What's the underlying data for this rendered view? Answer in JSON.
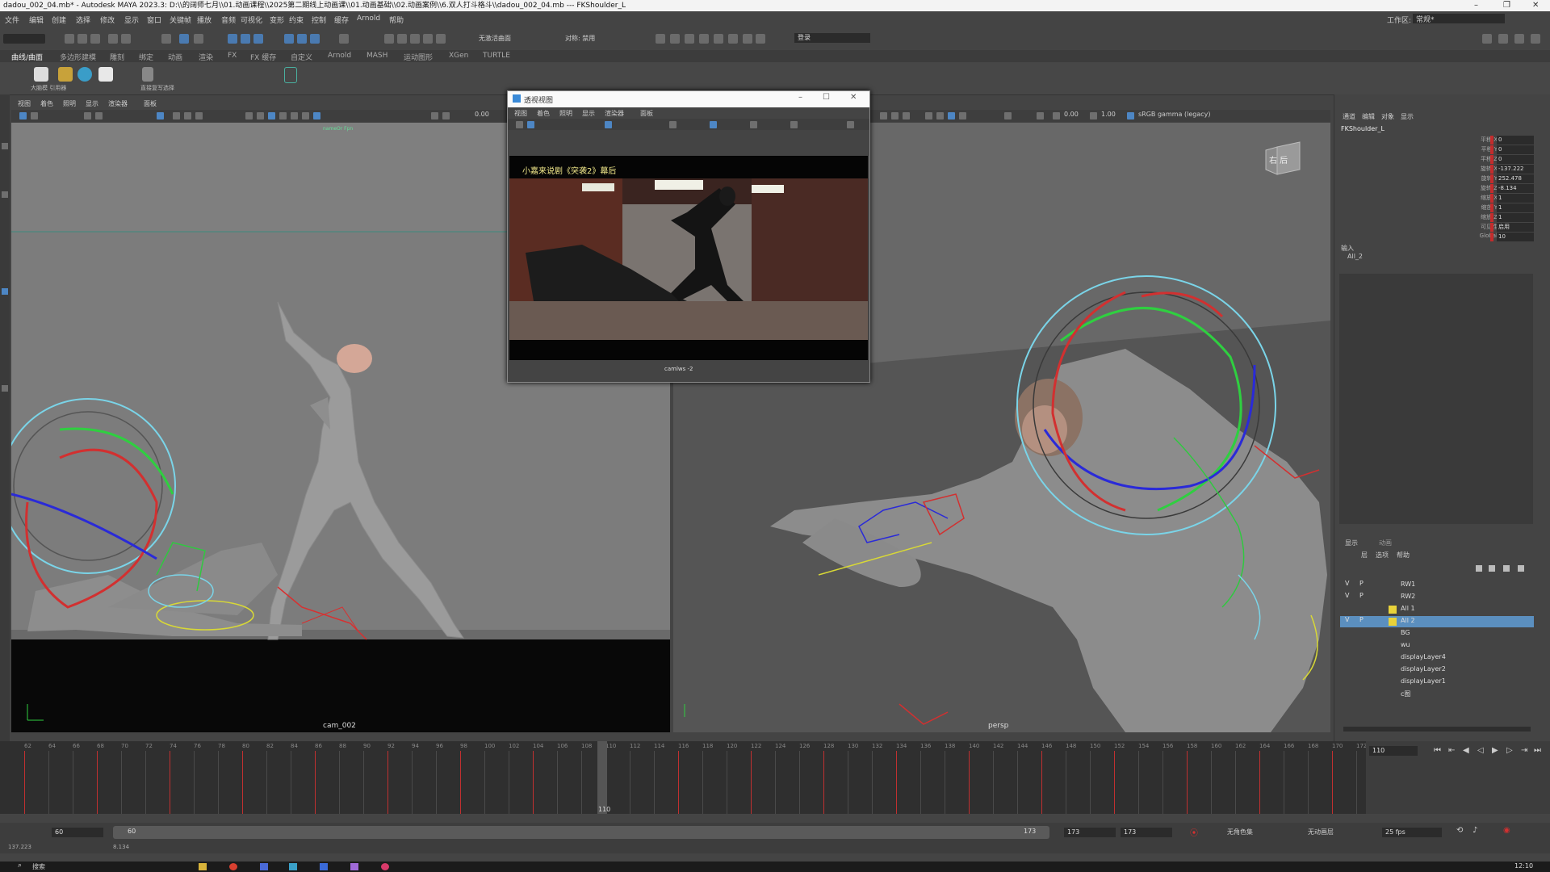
{
  "window": {
    "title": "dadou_002_04.mb* - Autodesk MAYA 2023.3: D:\\\\的阔师七月\\\\01.动画课程\\\\2025第二期线上动画课\\\\01.动画基础\\\\02.动画案例\\\\6.双人打斗格斗\\\\dadou_002_04.mb   ---   FKShoulder_L",
    "minimize": "–",
    "maximize": "❐",
    "close": "✕",
    "workspace_label": "工作区:",
    "workspace_value": "常规*"
  },
  "menubar": [
    "文件",
    "编辑",
    "创建",
    "选择",
    "修改",
    "显示",
    "窗口",
    "关键帧",
    "播放",
    "音频",
    "可视化",
    "变形",
    "约束",
    "控制",
    "缓存",
    "Arnold",
    "帮助"
  ],
  "toolbar": {
    "sym_off": "无激活曲面",
    "sym_label": "对称: 禁用",
    "login": "登录"
  },
  "shelf_tabs": [
    "曲线/曲面",
    "多边形建模",
    "雕刻",
    "绑定",
    "动画",
    "渲染",
    "FX",
    "FX 缓存",
    "自定义",
    "Arnold",
    "MASH",
    "运动图形",
    "XGen",
    "TURTLE"
  ],
  "shelf_captions": [
    "大脑模 引用器",
    "直接复写选择"
  ],
  "viewport_left": {
    "menus": [
      "视图",
      "着色",
      "照明",
      "显示",
      "渲染器",
      "面板"
    ],
    "field": "0.00",
    "camera_label": "cam_002",
    "top_label": "nameOr Fpn"
  },
  "viewport_right": {
    "menus": [
      "视图",
      "着色",
      "照明",
      "显示",
      "渲染器",
      "面板"
    ],
    "field1": "0.00",
    "field2": "1.00",
    "colorspace": "sRGB gamma (legacy)",
    "camera_label": "persp",
    "viewcube": "右 后"
  },
  "float_window": {
    "title": "透视视图",
    "menus": [
      "视图",
      "着色",
      "照明",
      "显示",
      "渲染器",
      "面板"
    ],
    "subtitle_text": "小嘉来说剧《突袭2》幕后",
    "camera_label": "camlws -2"
  },
  "channel_box": {
    "tabs": [
      "通道",
      "编辑",
      "对象",
      "显示"
    ],
    "object": "FKShoulder_L",
    "channels": [
      {
        "name": "平移 X",
        "value": "0"
      },
      {
        "name": "平移 Y",
        "value": "0"
      },
      {
        "name": "平移 Z",
        "value": "0"
      },
      {
        "name": "旋转 X",
        "value": "-137.222"
      },
      {
        "name": "旋转 Y",
        "value": "252.478"
      },
      {
        "name": "旋转 Z",
        "value": "-8.134"
      },
      {
        "name": "缩放 X",
        "value": "1"
      },
      {
        "name": "缩放 Y",
        "value": "1"
      },
      {
        "name": "缩放 Z",
        "value": "1"
      },
      {
        "name": "可见性",
        "value": "启用"
      },
      {
        "name": "Global",
        "value": "10"
      }
    ],
    "inputs_label": "输入",
    "inputs_value": "All_2"
  },
  "layer_editor": {
    "tabs": [
      "显示",
      "动画"
    ],
    "menus": [
      "层",
      "选项",
      "帮助"
    ],
    "layers": [
      {
        "v": "V",
        "p": "P",
        "name": "RW1",
        "color": "",
        "selected": false
      },
      {
        "v": "V",
        "p": "P",
        "name": "RW2",
        "color": "",
        "selected": false
      },
      {
        "v": "",
        "p": "",
        "name": "All 1",
        "color": "#e8d23a",
        "selected": false
      },
      {
        "v": "V",
        "p": "P",
        "name": "All 2",
        "color": "#e8d23a",
        "selected": true
      },
      {
        "v": "",
        "p": "",
        "name": "BG",
        "color": "",
        "selected": false
      },
      {
        "v": "",
        "p": "",
        "name": "wu",
        "color": "",
        "selected": false
      },
      {
        "v": "",
        "p": "",
        "name": "displayLayer4",
        "color": "",
        "selected": false
      },
      {
        "v": "",
        "p": "",
        "name": "displayLayer2",
        "color": "",
        "selected": false
      },
      {
        "v": "",
        "p": "",
        "name": "displayLayer1",
        "color": "",
        "selected": false
      },
      {
        "v": "",
        "p": "",
        "name": "c图",
        "color": "",
        "selected": false
      }
    ]
  },
  "timeline": {
    "ticks": [
      "62",
      "64",
      "66",
      "68",
      "70",
      "72",
      "74",
      "76",
      "78",
      "80",
      "82",
      "84",
      "86",
      "88",
      "90",
      "92",
      "94",
      "96",
      "98",
      "100",
      "102",
      "104",
      "106",
      "108",
      "110",
      "112",
      "114",
      "116",
      "118",
      "120",
      "122",
      "124",
      "126",
      "128",
      "130",
      "132",
      "134",
      "136",
      "138",
      "140",
      "142",
      "144",
      "146",
      "148",
      "150",
      "152",
      "154",
      "156",
      "158",
      "160",
      "162",
      "164",
      "166",
      "168",
      "170",
      "172"
    ],
    "current_frame": "110",
    "current_frame_field": "110",
    "start_min": "60",
    "start": "60",
    "end": "173",
    "end_field": "173",
    "end_max": "173",
    "character_set": "无角色集",
    "anim_layer": "无动画层",
    "fps": "25 fps"
  },
  "statusline": {
    "left": "137.223",
    "right": "8.134"
  },
  "taskbar": {
    "search": "搜索",
    "clock": "12:10"
  },
  "colors": {
    "accent": "#4d86c4",
    "keyframe": "#c03030",
    "layer_selected": "#5b8fbf",
    "channel_marker": "#c32c2c"
  }
}
